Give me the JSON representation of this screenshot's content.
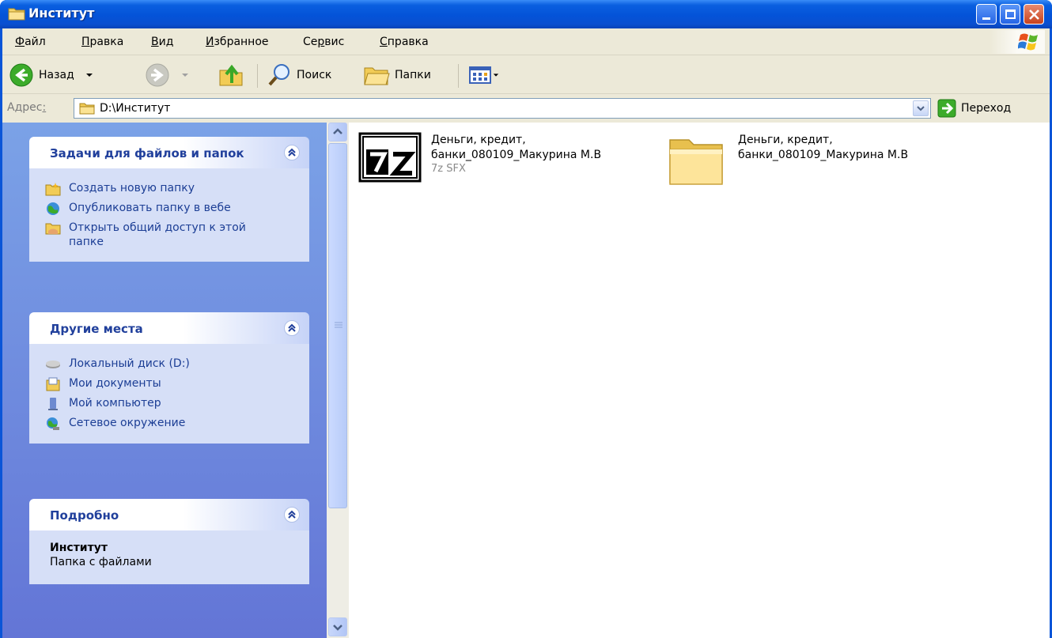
{
  "window": {
    "title": "Институт",
    "icon": "folder-icon"
  },
  "menu": [
    {
      "key": "Ф",
      "rest": "айл"
    },
    {
      "key": "П",
      "rest": "равка"
    },
    {
      "key": "В",
      "rest": "ид"
    },
    {
      "key": "И",
      "rest": "збранное"
    },
    {
      "pre": "Се",
      "key": "р",
      "rest": "вис"
    },
    {
      "key": "С",
      "rest": "правка"
    }
  ],
  "toolbar": {
    "back_label": "Назад",
    "search_label": "Поиск",
    "folders_label": "Папки"
  },
  "address": {
    "label_pre": "Адрес",
    "label_key": ":",
    "value": "D:\\Институт",
    "go_label": "Переход"
  },
  "tasks_panel": {
    "title": "Задачи для файлов и папок",
    "items": [
      {
        "label": "Создать новую папку",
        "icon": "new-folder-icon"
      },
      {
        "label": "Опубликовать папку в вебе",
        "icon": "publish-web-icon"
      },
      {
        "label": "Открыть общий доступ к этой папке",
        "icon": "share-folder-icon"
      }
    ]
  },
  "places_panel": {
    "title": "Другие места",
    "items": [
      {
        "label": "Локальный диск (D:)",
        "icon": "drive-icon"
      },
      {
        "label": "Мои документы",
        "icon": "my-documents-icon"
      },
      {
        "label": "Мой компьютер",
        "icon": "my-computer-icon"
      },
      {
        "label": "Сетевое окружение",
        "icon": "network-icon"
      }
    ]
  },
  "details_panel": {
    "title": "Подробно",
    "name": "Институт",
    "kind": "Папка с файлами"
  },
  "files": [
    {
      "name_line1": "Деньги, кредит,",
      "name_line2": "банки_080109_Макурина М.В",
      "type": "7z SFX",
      "icon": "7z-archive-icon"
    },
    {
      "name_line1": "Деньги, кредит,",
      "name_line2": "банки_080109_Макурина М.В",
      "type": "",
      "icon": "folder-icon"
    }
  ]
}
